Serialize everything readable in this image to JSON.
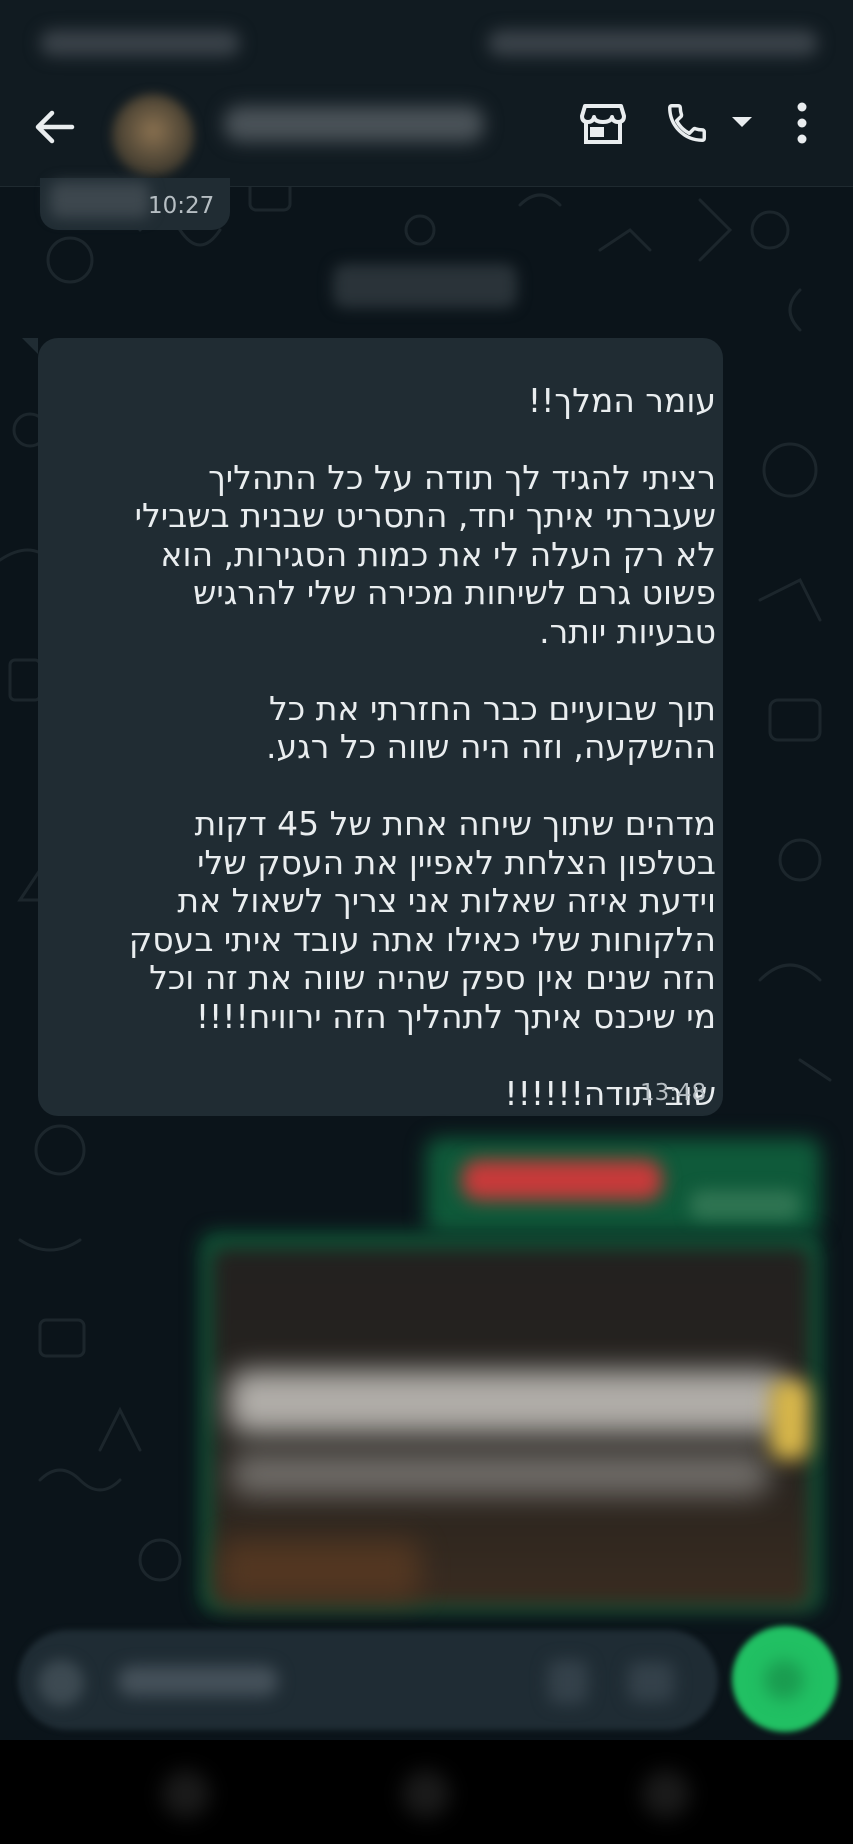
{
  "prev_message": {
    "time": "10:27"
  },
  "message": {
    "direction": "incoming",
    "lines": [
      "עומר המלך!!",
      "רציתי להגיד לך תודה על כל התהליך שעברתי איתך יחד, התסריט שבנית בשבילי לא רק העלה לי את כמות הסגירות, הוא פשוט גרם לשיחות מכירה שלי להרגיש טבעיות יותר.",
      "תוך שבועיים כבר החזרתי את כל ההשקעה, וזה היה שווה כל רגע.",
      "מדהים שתוך שיחה אחת של 45 דקות בטלפון הצלחת לאפיין את העסק שלי וידעת איזה שאלות אני צריך לשאול את הלקוחות שלי כאילו אתה עובד איתי בעסק הזה שנים אין ספק שהיה שווה את זה וכל מי שיכנס איתך לתהליך הזה ירוויח!!!!",
      "שוב תודה!!!!!!"
    ],
    "time": "13:48"
  },
  "colors": {
    "background": "#0b141a",
    "header": "#111b21",
    "incoming_bubble": "#202c33",
    "text": "#e9edef",
    "accent_green": "#21c063"
  },
  "icons": {
    "back": "arrow-left-icon",
    "shop": "storefront-icon",
    "call": "phone-icon",
    "call_menu": "caret-down-icon",
    "more": "more-vert-icon"
  }
}
